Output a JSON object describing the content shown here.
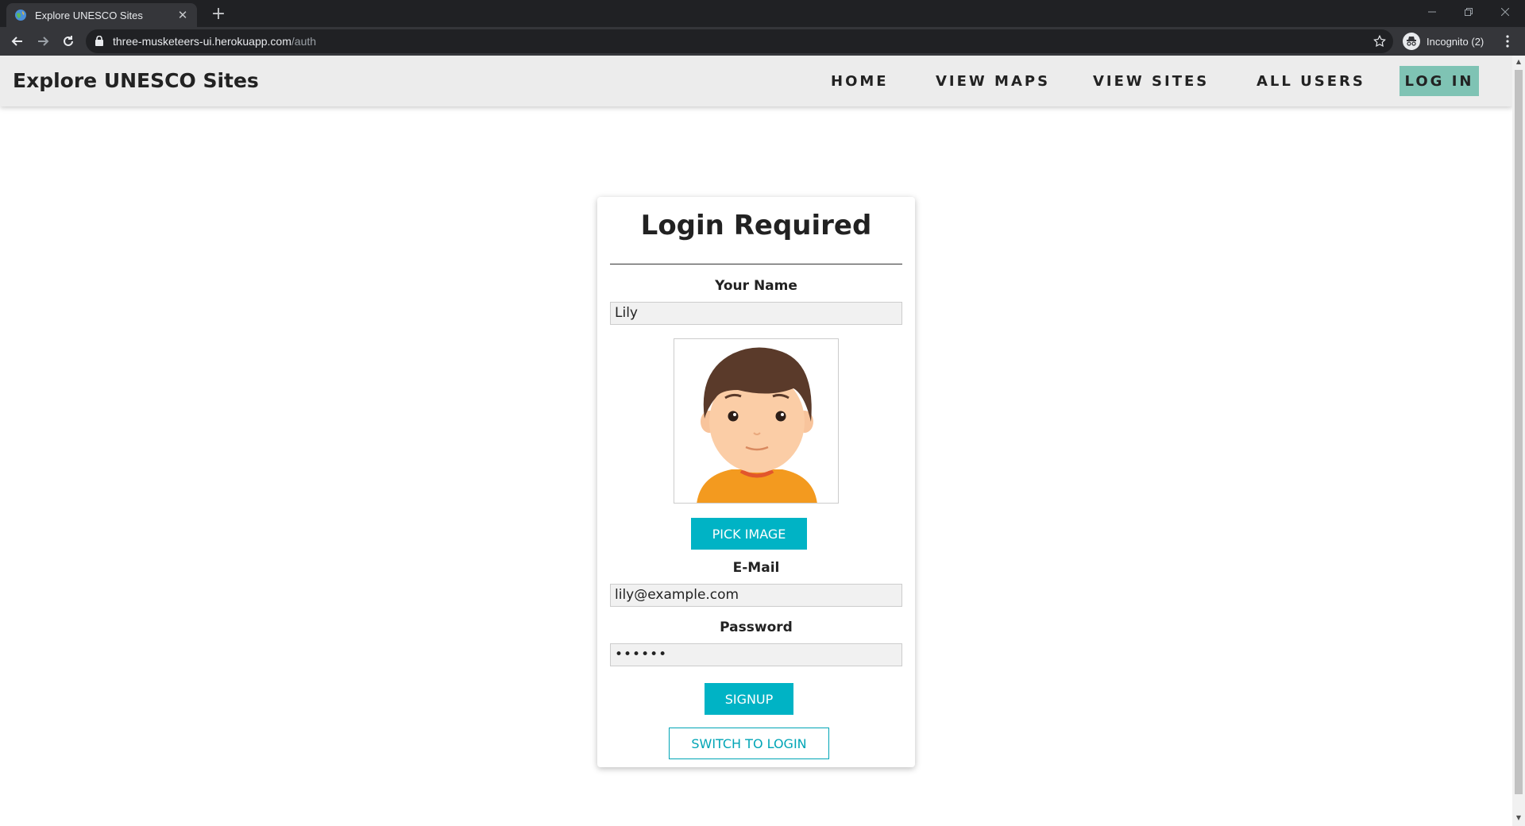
{
  "browser": {
    "tab_title": "Explore UNESCO Sites",
    "tab_close": "✕",
    "new_tab": "+",
    "url_host": "three-musketeers-ui.herokuapp.com",
    "url_path": "/auth",
    "profile_label": "Incognito (2)"
  },
  "header": {
    "brand": "Explore UNESCO Sites",
    "nav": {
      "home": "HOME",
      "view_maps": "VIEW MAPS",
      "view_sites": "VIEW SITES",
      "all_users": "ALL USERS",
      "log_in": "LOG IN"
    }
  },
  "auth_form": {
    "title": "Login Required",
    "name_label": "Your Name",
    "name_value": "Lily",
    "pick_image_label": "PICK IMAGE",
    "email_label": "E-Mail",
    "email_value": "lily@example.com",
    "password_label": "Password",
    "password_value": "••••••",
    "signup_label": "SIGNUP",
    "switch_label": "SWITCH TO LOGIN"
  },
  "colors": {
    "accent": "#00b3c5",
    "login_highlight": "#7fc3b4",
    "header_bg": "#ececec"
  }
}
